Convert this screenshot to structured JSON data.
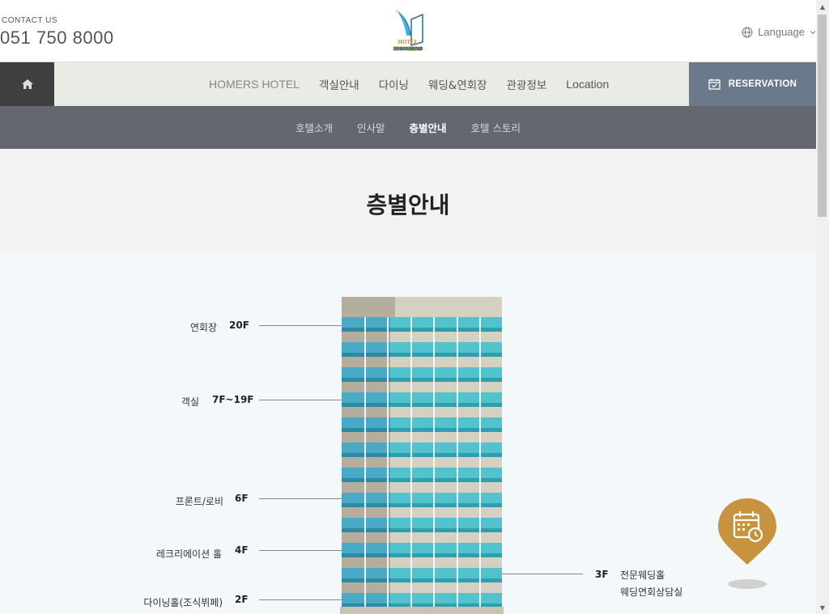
{
  "header": {
    "contact_label": "CONTACT US",
    "contact_phone": "051 750 8000",
    "logo_line1": "HOTEL",
    "logo_line2": "HOMERS",
    "language_label": "Language"
  },
  "nav": {
    "items": [
      {
        "label": "HOMERS HOTEL"
      },
      {
        "label": "객실안내"
      },
      {
        "label": "다이닝"
      },
      {
        "label": "웨딩&연회장"
      },
      {
        "label": "관광정보"
      },
      {
        "label": "Location"
      }
    ],
    "reservation_label": "RESERVATION"
  },
  "subnav": {
    "items": [
      {
        "label": "호텔소개"
      },
      {
        "label": "인사말"
      },
      {
        "label": "층별안내"
      },
      {
        "label": "호텔 스토리"
      }
    ]
  },
  "page_title": "층별안내",
  "floors": [
    {
      "name": "연회장",
      "floor": "20F"
    },
    {
      "name": "객실",
      "floor": "7F~19F"
    },
    {
      "name": "프론트/로비",
      "floor": "6F"
    },
    {
      "name": "레크리에이션 홀",
      "floor": "4F"
    },
    {
      "name": "다이닝홀(조식뷔페)",
      "floor": "2F"
    }
  ],
  "right_floor": {
    "floor": "3F",
    "line1": "전문웨딩홀",
    "line2": "웨딩연회상담실"
  },
  "colors": {
    "nav_bg": "#e9ece4",
    "home_bg": "#3f3f3f",
    "reservation_bg": "#6a7a8a",
    "subnav_bg": "#636870",
    "fab": "#c8933f",
    "building_glass": "#4dbfcc"
  }
}
